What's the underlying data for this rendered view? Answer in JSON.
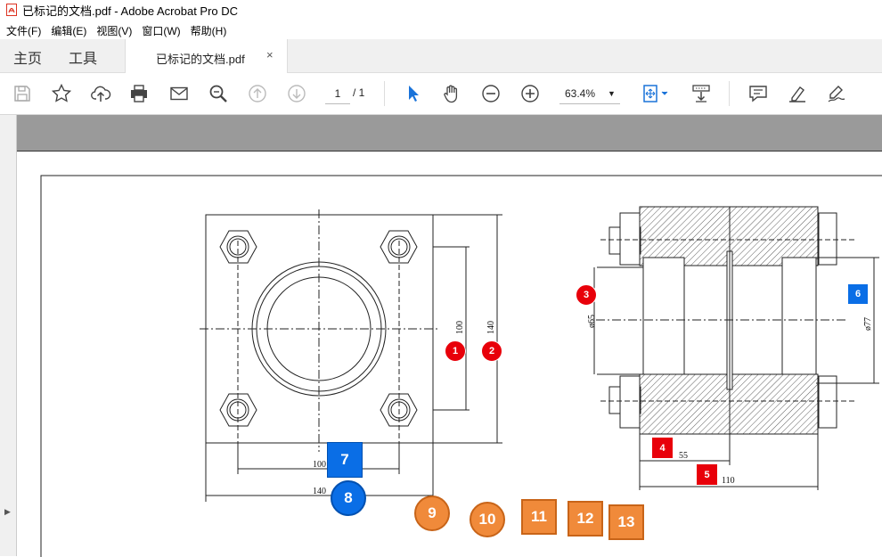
{
  "window": {
    "title": "已标记的文档.pdf - Adobe Acrobat Pro DC"
  },
  "menu": {
    "items": [
      "文件(F)",
      "编辑(E)",
      "视图(V)",
      "窗口(W)",
      "帮助(H)"
    ]
  },
  "tabs": {
    "home": "主页",
    "tools": "工具",
    "document": "已标记的文档.pdf",
    "close": "×"
  },
  "toolbar": {
    "page_current": "1",
    "page_total": "/ 1",
    "zoom": "63.4%"
  },
  "icons": [
    "save-icon",
    "star-icon",
    "upload-icon",
    "print-icon",
    "mail-icon",
    "zoom-search-icon",
    "page-up-icon",
    "page-down-icon",
    "select-arrow-icon",
    "hand-icon",
    "zoom-out-icon",
    "zoom-in-icon",
    "fit-page-icon",
    "scroll-mode-icon",
    "comment-icon",
    "highlight-icon",
    "sign-icon"
  ],
  "drawing_dims": {
    "d100_vert": "100",
    "d140_vert": "140",
    "d100_horiz": "100",
    "d140_horiz": "140",
    "d65": "ø65",
    "d77": "ø77",
    "d55": "55",
    "d110": "110"
  },
  "markers": {
    "m1": "1",
    "m2": "2",
    "m3": "3",
    "m4": "4",
    "m5": "5",
    "m6": "6",
    "m7": "7",
    "m8": "8",
    "m9": "9",
    "m10": "10",
    "m11": "11",
    "m12": "12",
    "m13": "13"
  },
  "colors": {
    "marker_red": "#e8000a",
    "marker_blue": "#0a6ee6",
    "marker_orange": "#f08a3a",
    "accent": "#1a73d9"
  }
}
